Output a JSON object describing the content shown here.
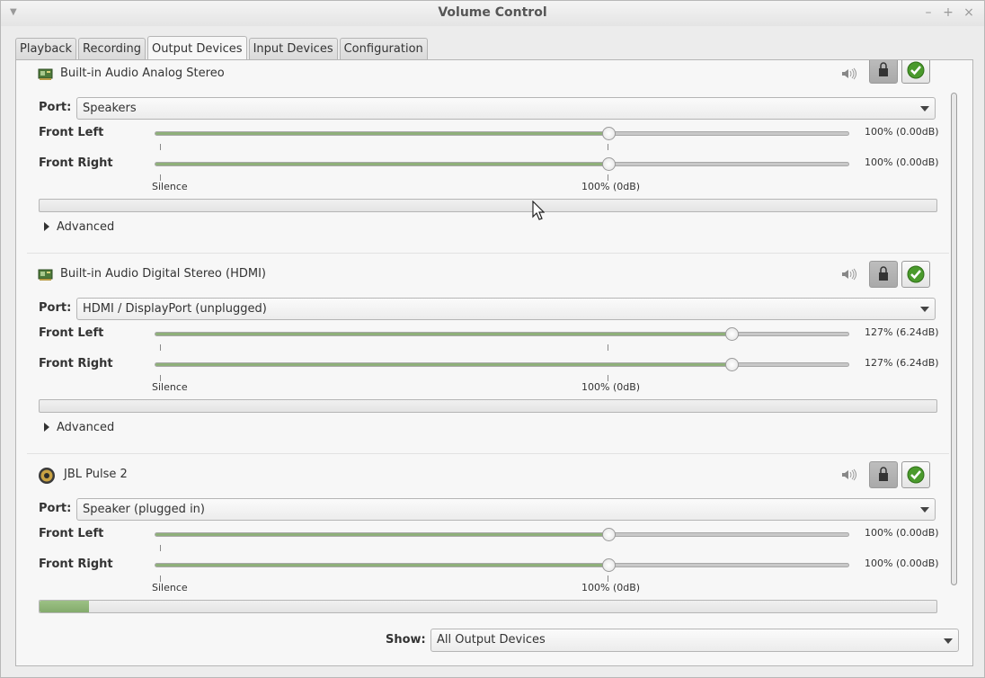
{
  "window": {
    "title": "Volume Control",
    "controls": [
      "minimize",
      "maximize",
      "close"
    ]
  },
  "tabs": [
    {
      "label": "Playback",
      "active": false
    },
    {
      "label": "Recording",
      "active": false
    },
    {
      "label": "Output Devices",
      "active": true
    },
    {
      "label": "Input Devices",
      "active": false
    },
    {
      "label": "Configuration",
      "active": false
    }
  ],
  "labels": {
    "port": "Port:",
    "front_left": "Front Left",
    "front_right": "Front Right",
    "silence": "Silence",
    "hundred": "100% (0dB)",
    "advanced": "Advanced",
    "show": "Show:"
  },
  "devices": [
    {
      "name": "Built-in Audio Analog Stereo",
      "icon": "sound-card-icon",
      "port": "Speakers",
      "front_left": {
        "percent": 100,
        "text": "100% (0.00dB)"
      },
      "front_right": {
        "percent": 100,
        "text": "100% (0.00dB)"
      },
      "peak_level": 0,
      "locked": true,
      "is_default": true
    },
    {
      "name": "Built-in Audio Digital Stereo (HDMI)",
      "icon": "sound-card-icon",
      "port": "HDMI / DisplayPort (unplugged)",
      "front_left": {
        "percent": 127,
        "text": "127% (6.24dB)"
      },
      "front_right": {
        "percent": 127,
        "text": "127% (6.24dB)"
      },
      "peak_level": 0,
      "locked": true,
      "is_default": false
    },
    {
      "name": "JBL Pulse 2",
      "icon": "speaker-icon",
      "port": "Speaker (plugged in)",
      "front_left": {
        "percent": 100,
        "text": "100% (0.00dB)"
      },
      "front_right": {
        "percent": 100,
        "text": "100% (0.00dB)"
      },
      "peak_level": 0.055,
      "locked": true,
      "is_default": false
    }
  ],
  "slider_max_percent": 153,
  "show": {
    "value": "All Output Devices"
  },
  "colors": {
    "accent_green": "#8fb07a",
    "check_green": "#4a9a2c"
  }
}
